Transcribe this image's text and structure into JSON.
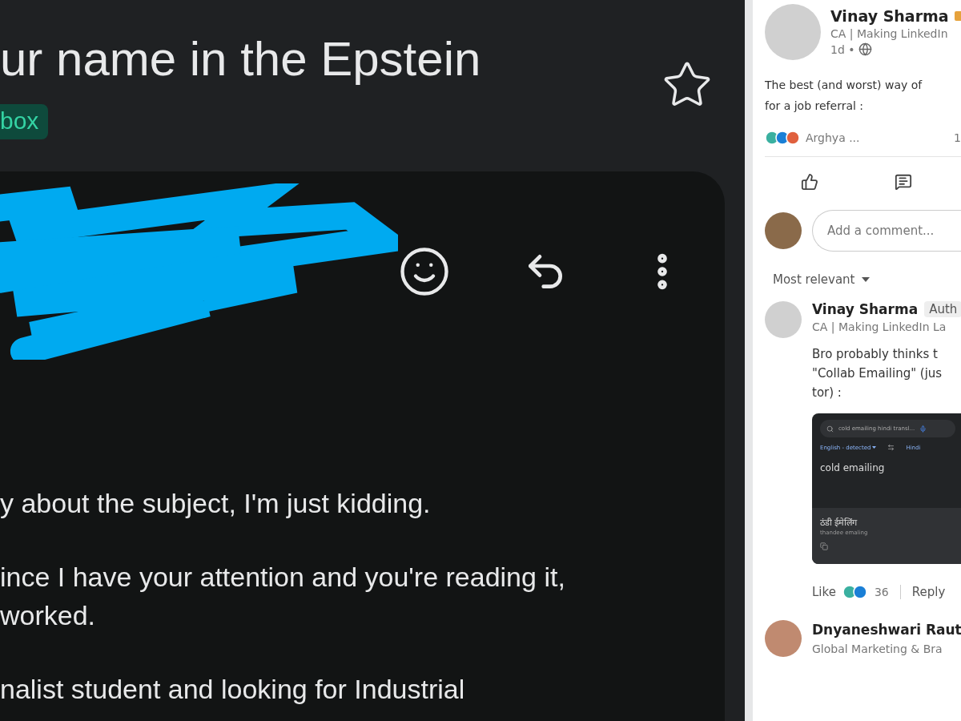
{
  "email": {
    "subject": "ur name in the Epstein",
    "label": "box",
    "paragraphs": [
      [
        "y about the subject, I'm just kidding."
      ],
      [
        "ince I have your attention and you're reading it,",
        "worked."
      ],
      [
        "nalist student and looking for Industrial"
      ]
    ]
  },
  "post": {
    "author": {
      "name": "Vinay Sharma",
      "headline": "CA | Making LinkedIn",
      "time": "1d •"
    },
    "text_lines": [
      "The best (and worst) way of",
      "for a job referral :"
    ],
    "reactions": {
      "names": "Arghya ...",
      "count": "1"
    },
    "comment_box": {
      "placeholder": "Add a comment..."
    },
    "sort": {
      "label": "Most relevant"
    },
    "comments": [
      {
        "name": "Vinay Sharma",
        "badge": "Auth",
        "headline": "CA | Making LinkedIn La",
        "text_lines": [
          "Bro probably thinks t",
          "\"Collab Emailing\" (jus",
          "tor) :"
        ],
        "attachment": {
          "search": "cold emailing hindi transl...",
          "source_language": "English - detected",
          "target_language": "Hindi",
          "source_text": "cold emailing",
          "translation": "ठंडी ईमेलिंग",
          "transliteration": "thandee emaling"
        },
        "like_label": "Like",
        "reaction_count": "36",
        "reply_label": "Reply"
      },
      {
        "name": "Dnyaneshwari Raut",
        "headline": "Global Marketing & Bra"
      }
    ]
  }
}
